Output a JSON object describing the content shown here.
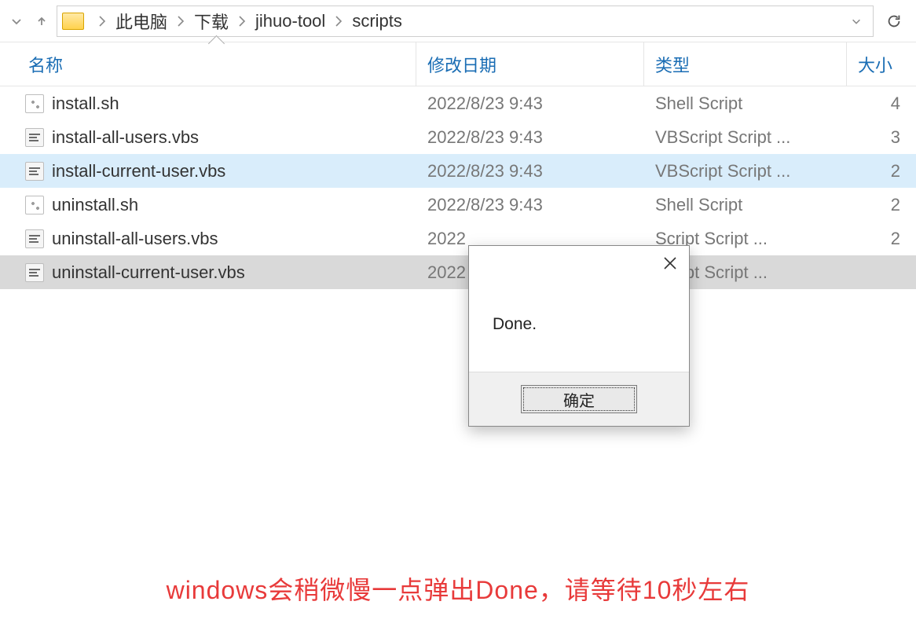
{
  "breadcrumb": {
    "items": [
      "此电脑",
      "下载",
      "jihuo-tool",
      "scripts"
    ]
  },
  "columns": {
    "name": "名称",
    "date": "修改日期",
    "type": "类型",
    "size": "大小"
  },
  "files": [
    {
      "name": "install.sh",
      "date": "2022/8/23 9:43",
      "type": "Shell Script",
      "size": "4",
      "icon": "sh",
      "state": ""
    },
    {
      "name": "install-all-users.vbs",
      "date": "2022/8/23 9:43",
      "type": "VBScript Script ...",
      "size": "3",
      "icon": "vbs",
      "state": ""
    },
    {
      "name": "install-current-user.vbs",
      "date": "2022/8/23 9:43",
      "type": "VBScript Script ...",
      "size": "2",
      "icon": "vbs",
      "state": "selected"
    },
    {
      "name": "uninstall.sh",
      "date": "2022/8/23 9:43",
      "type": "Shell Script",
      "size": "2",
      "icon": "sh",
      "state": ""
    },
    {
      "name": "uninstall-all-users.vbs",
      "date": "2022",
      "type": "Script Script ...",
      "size": "2",
      "icon": "vbs",
      "state": ""
    },
    {
      "name": "uninstall-current-user.vbs",
      "date": "2022",
      "type": "Script Script ...",
      "size": "",
      "icon": "vbs",
      "state": "highlight"
    }
  ],
  "dialog": {
    "message": "Done.",
    "ok_label": "确定"
  },
  "annotation": "windows会稍微慢一点弹出Done，请等待10秒左右"
}
